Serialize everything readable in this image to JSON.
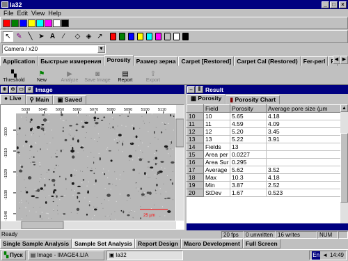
{
  "window": {
    "title": "Ia32"
  },
  "menu": [
    "File",
    "Edit",
    "View",
    "Help"
  ],
  "colors": {
    "swatches": [
      "#ff0000",
      "#008000",
      "#0000ff",
      "#ffff00",
      "#00ffff",
      "#ff00ff",
      "#ffffff",
      "#000000"
    ],
    "cans": [
      "#ff0000",
      "#008000",
      "#0000ff",
      "#ffff00",
      "#00ffff",
      "#ff00ff",
      "#c0c0c0",
      "#ffffff",
      "#000000"
    ]
  },
  "camera": {
    "value": "Camera / x20"
  },
  "tabs": [
    "Application",
    "Быстрые измерения",
    "Porosity",
    "Размер зерна",
    "Carpet [Restored]",
    "Carpet Cal (Restored)",
    "Fer-perl",
    "R"
  ],
  "commands": [
    {
      "label": "Threshold",
      "icon": "threshold-icon",
      "enabled": true
    },
    {
      "label": "New",
      "icon": "flag-icon",
      "enabled": true
    },
    {
      "label": "Analyze",
      "icon": "play-icon",
      "enabled": false
    },
    {
      "label": "Save Image",
      "icon": "camera-icon",
      "enabled": false
    },
    {
      "label": "Report",
      "icon": "report-icon",
      "enabled": true
    },
    {
      "label": "Export",
      "icon": "export-icon",
      "enabled": false
    }
  ],
  "image_panel": {
    "title": "Image",
    "tabs": [
      "Live",
      "Main",
      "Saved"
    ],
    "x_ticks": [
      "5030",
      "5040",
      "5050",
      "5060",
      "5070",
      "5080",
      "5090",
      "5100",
      "5110"
    ],
    "y_ticks": [
      "-1500",
      "-1510",
      "-1520",
      "-1530",
      "-1540"
    ],
    "scale_label": "25 µm"
  },
  "result_panel": {
    "title": "Result",
    "tabs": [
      "Porosity",
      "Porosity Chart"
    ],
    "columns": [
      "Field",
      "Porosity",
      "Average pore size (µm"
    ],
    "rows": [
      {
        "n": "10",
        "field": "10",
        "porosity": "5.65",
        "avg": "4.18"
      },
      {
        "n": "11",
        "field": "11",
        "porosity": "4.59",
        "avg": "4.09"
      },
      {
        "n": "12",
        "field": "12",
        "porosity": "5.20",
        "avg": "3.45"
      },
      {
        "n": "13",
        "field": "13",
        "porosity": "5.22",
        "avg": "3.91"
      },
      {
        "n": "14",
        "field": "Fields",
        "porosity": "13",
        "avg": ""
      },
      {
        "n": "15",
        "field": "Area per",
        "porosity": "0.0227",
        "avg": ""
      },
      {
        "n": "16",
        "field": "Area Sur",
        "porosity": "0.295",
        "avg": ""
      },
      {
        "n": "17",
        "field": "Average",
        "porosity": "5.62",
        "avg": "3.52"
      },
      {
        "n": "18",
        "field": "Max",
        "porosity": "10.3",
        "avg": "4.18"
      },
      {
        "n": "19",
        "field": "Min",
        "porosity": "3.87",
        "avg": "2.52"
      },
      {
        "n": "20",
        "field": "StDev",
        "porosity": "1.67",
        "avg": "0.523"
      }
    ]
  },
  "status": {
    "ready": "Ready",
    "fps": "20 fps",
    "unwritten": "0 unwritten",
    "writes": "16 writes",
    "num": "NUM"
  },
  "bottom_tabs": [
    "Single Sample Analysis",
    "Sample Set Analysis",
    "Report Design",
    "Macro Development",
    "Full Screen"
  ],
  "taskbar": {
    "start": "Пуск",
    "items": [
      "Image - IMAGE4.LIA",
      "Ia32"
    ],
    "lang": "En",
    "time": "14:49"
  }
}
